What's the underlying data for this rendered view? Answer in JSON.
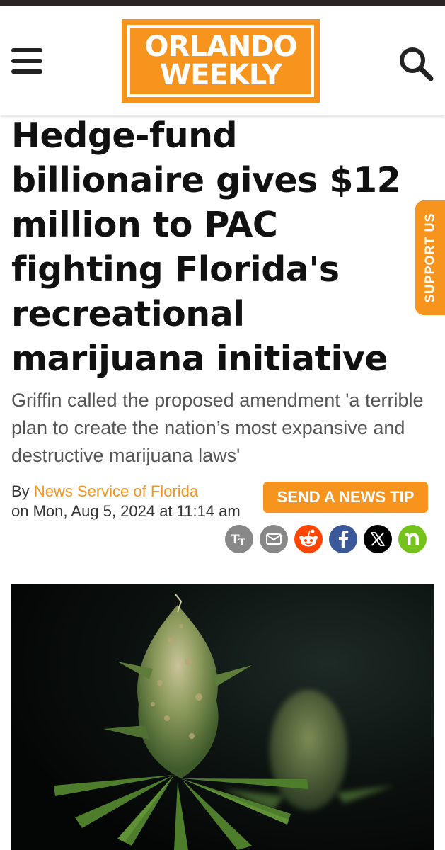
{
  "header": {
    "logo_line1": "ORLANDO",
    "logo_line2": "WEEKLY",
    "menu_icon": "hamburger-menu-icon",
    "search_icon": "search-icon"
  },
  "article": {
    "headline": "Hedge-fund billionaire gives $12 million to PAC fighting Florida's recreational marijuana initiative",
    "subheadline": "Griffin called the proposed amendment 'a terrible plan to create the nation’s most expansive and destructive marijuana laws'",
    "byline_prefix": "By",
    "author": "News Service of Florida",
    "date_prefix": "on",
    "date": "Mon, Aug 5, 2024 at 11:14 am"
  },
  "actions": {
    "support_label": "SUPPORT US",
    "tip_label": "SEND A NEWS TIP"
  },
  "share": [
    {
      "icon": "text-size-icon",
      "color": "#888888"
    },
    {
      "icon": "email-icon",
      "color": "#888888"
    },
    {
      "icon": "reddit-icon",
      "color": "#ff4500"
    },
    {
      "icon": "facebook-icon",
      "color": "#3b5998"
    },
    {
      "icon": "x-icon",
      "color": "#000000"
    },
    {
      "icon": "nextdoor-icon",
      "color": "#76c21d"
    }
  ],
  "colors": {
    "brand_orange": "#f7941d",
    "top_bar": "#2c2324"
  },
  "hero_image": {
    "subject": "cannabis-plant-image"
  }
}
